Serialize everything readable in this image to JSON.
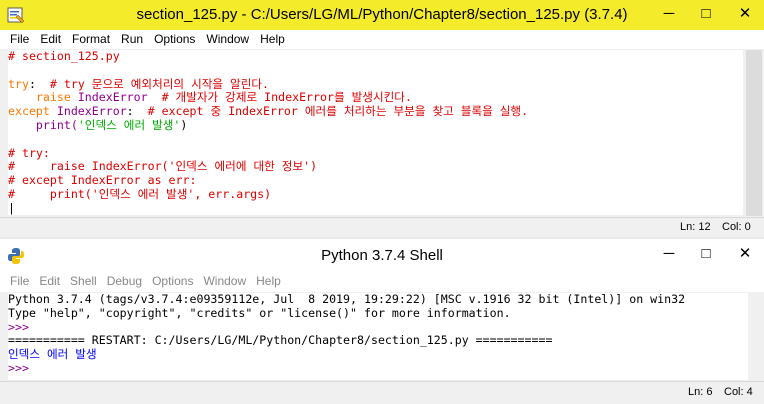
{
  "editor": {
    "title": "section_125.py  -  C:/Users/LG/ML/Python/Chapter8/section_125.py (3.7.4)",
    "menu": [
      "File",
      "Edit",
      "Format",
      "Run",
      "Options",
      "Window",
      "Help"
    ],
    "lines": [
      [
        {
          "t": "# section_125.py",
          "c": "red"
        }
      ],
      [
        {
          "t": "",
          "c": "black"
        }
      ],
      [
        {
          "t": "try",
          "c": "orange"
        },
        {
          "t": ":  ",
          "c": "black"
        },
        {
          "t": "# try 문으로 예외처리의 시작을 알린다.",
          "c": "red"
        }
      ],
      [
        {
          "t": "    ",
          "c": "black"
        },
        {
          "t": "raise",
          "c": "orange"
        },
        {
          "t": " IndexError  ",
          "c": "purple"
        },
        {
          "t": "# 개발자가 강제로 IndexError를 발생시킨다.",
          "c": "red"
        }
      ],
      [
        {
          "t": "except",
          "c": "orange"
        },
        {
          "t": " IndexError",
          "c": "purple"
        },
        {
          "t": ":  ",
          "c": "black"
        },
        {
          "t": "# except 중 IndexError 에러를 처리하는 부분을 찾고 블록을 실행.",
          "c": "red"
        }
      ],
      [
        {
          "t": "    print(",
          "c": "purple"
        },
        {
          "t": "'인덱스 에러 발생'",
          "c": "green"
        },
        {
          "t": ")",
          "c": "black"
        }
      ],
      [
        {
          "t": "",
          "c": "black"
        }
      ],
      [
        {
          "t": "# try:",
          "c": "red"
        }
      ],
      [
        {
          "t": "#     raise IndexError('인덱스 에러에 대한 정보')",
          "c": "red"
        }
      ],
      [
        {
          "t": "# except IndexError as err:",
          "c": "red"
        }
      ],
      [
        {
          "t": "#     print('인덱스 에러 발생', err.args)",
          "c": "red"
        }
      ],
      [
        {
          "t": "|",
          "c": "black"
        }
      ]
    ],
    "status": {
      "ln": "Ln: 12",
      "col": "Col: 0"
    },
    "buttons": {
      "min": "─",
      "max": "□",
      "close": "✕"
    }
  },
  "shell": {
    "title": "Python 3.7.4 Shell",
    "menu": [
      "File",
      "Edit",
      "Shell",
      "Debug",
      "Options",
      "Window",
      "Help"
    ],
    "lines": [
      [
        {
          "t": "Python 3.7.4 (tags/v3.7.4:e09359112e, Jul  8 2019, 19:29:22) [MSC v.1916 32 bit (Intel)] on win32",
          "c": "black"
        }
      ],
      [
        {
          "t": "Type \"help\", \"copyright\", \"credits\" or \"license()\" for more information.",
          "c": "black"
        }
      ],
      [
        {
          "t": ">>> ",
          "c": "purple"
        }
      ],
      [
        {
          "t": "=========== RESTART: C:/Users/LG/ML/Python/Chapter8/section_125.py ===========",
          "c": "black"
        }
      ],
      [
        {
          "t": "인덱스 에러 발생",
          "c": "blue"
        }
      ],
      [
        {
          "t": ">>> ",
          "c": "purple"
        }
      ]
    ],
    "status": {
      "ln": "Ln: 6",
      "col": "Col: 4"
    },
    "buttons": {
      "min": "─",
      "max": "□",
      "close": "✕"
    }
  }
}
